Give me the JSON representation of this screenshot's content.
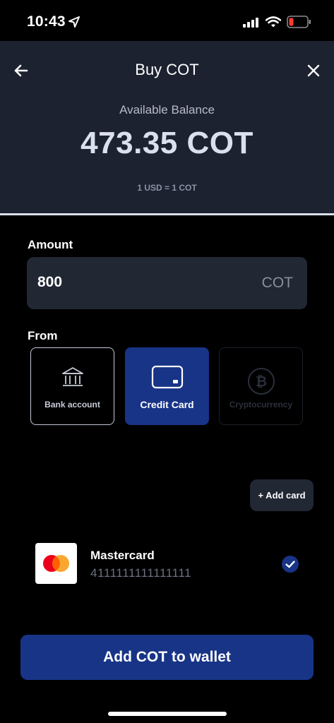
{
  "status_bar": {
    "time": "10:43",
    "icons": [
      "location-arrow-icon",
      "cellular-signal-icon",
      "wifi-icon",
      "battery-low-icon"
    ],
    "battery_color": "#ff3b30"
  },
  "header": {
    "title": "Buy COT",
    "balance_label": "Available Balance",
    "balance_value": "473.35 COT",
    "rate": "1 USD = 1 COT",
    "icons": [
      "back-arrow-icon",
      "close-icon"
    ]
  },
  "amount": {
    "label": "Amount",
    "value": "800",
    "unit": "COT"
  },
  "from": {
    "label": "From",
    "options": [
      {
        "label": "Bank account",
        "icon": "bank-icon",
        "state": "enabled"
      },
      {
        "label": "Credit Card",
        "icon": "credit-card-icon",
        "state": "selected"
      },
      {
        "label": "Cryptocurrency",
        "icon": "bitcoin-icon",
        "state": "disabled"
      }
    ]
  },
  "add_card_label": "+ Add card",
  "card": {
    "name": "Mastercard",
    "number": "4111111111111111",
    "icon": "mastercard-logo-icon",
    "selected": true
  },
  "cta_label": "Add COT to wallet",
  "colors": {
    "accent": "#183487",
    "header_bg": "#1c2230",
    "field_bg": "#222734"
  }
}
